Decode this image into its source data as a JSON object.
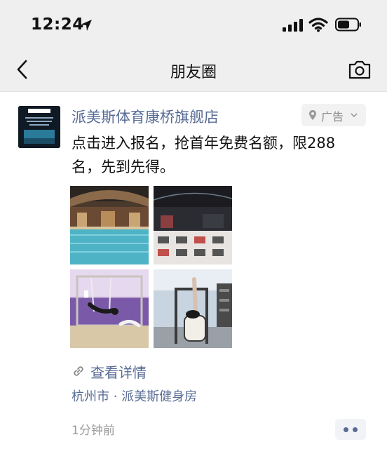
{
  "status_bar": {
    "time": "12:24"
  },
  "nav": {
    "title": "朋友圈"
  },
  "post": {
    "author": "派美斯体育康桥旗舰店",
    "ad_label": "广告",
    "text": "点击进入报名，抢首年免费名额，限288名，先到先得。",
    "details_label": "查看详情",
    "location": "杭州市 · 派美斯健身房",
    "time": "1分钟前",
    "avatar_logo_text": "PAIMEISI",
    "images": [
      {
        "icon": "indoor-pool-photo"
      },
      {
        "icon": "gym-floor-photo"
      },
      {
        "icon": "aerial-yoga-photo"
      },
      {
        "icon": "pilates-reformer-photo"
      }
    ]
  },
  "colors": {
    "link": "#576b95",
    "bar_bg": "#efefef",
    "text": "#111111",
    "muted": "#9a9a9a"
  }
}
